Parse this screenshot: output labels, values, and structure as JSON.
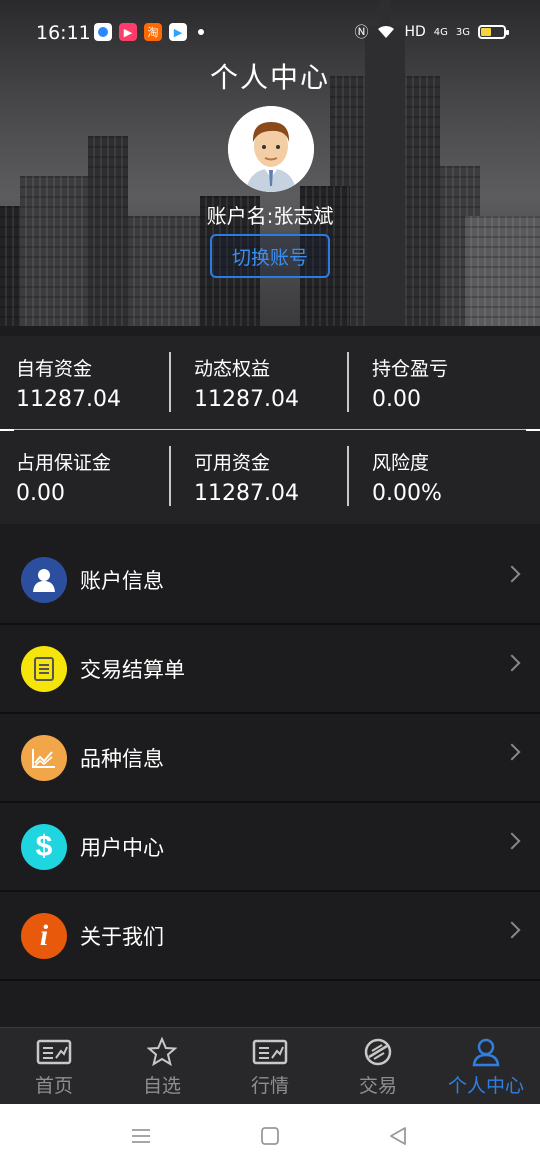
{
  "status_bar": {
    "time": "16:11",
    "network": "HD",
    "signal_1": "4G",
    "signal_2": "3G",
    "battery_level": 0.45
  },
  "header": {
    "title": "个人中心",
    "account_name": "账户名:张志斌",
    "switch_account_label": "切换账号"
  },
  "stats": [
    {
      "label": "自有资金",
      "value": "11287.04"
    },
    {
      "label": "动态权益",
      "value": "11287.04"
    },
    {
      "label": "持仓盈亏",
      "value": "0.00"
    },
    {
      "label": "占用保证金",
      "value": "0.00"
    },
    {
      "label": "可用资金",
      "value": "11287.04"
    },
    {
      "label": "风险度",
      "value": "0.00%"
    }
  ],
  "menu": {
    "items": [
      {
        "label": "账户信息",
        "icon": "user-icon",
        "color": "#2b4f9e"
      },
      {
        "label": "交易结算单",
        "icon": "document-icon",
        "color": "#f5e50a"
      },
      {
        "label": "品种信息",
        "icon": "chart-icon",
        "color": "#f2a64a"
      },
      {
        "label": "用户中心",
        "icon": "dollar-icon",
        "color": "#1fd5e0"
      },
      {
        "label": "关于我们",
        "icon": "info-icon",
        "color": "#e8590c"
      }
    ]
  },
  "tabbar": {
    "items": [
      {
        "label": "首页",
        "icon": "home-card-icon"
      },
      {
        "label": "自选",
        "icon": "star-icon"
      },
      {
        "label": "行情",
        "icon": "market-card-icon"
      },
      {
        "label": "交易",
        "icon": "trade-icon"
      },
      {
        "label": "个人中心",
        "icon": "person-icon"
      }
    ],
    "active_index": 4,
    "active_color": "#2f7fe0"
  }
}
